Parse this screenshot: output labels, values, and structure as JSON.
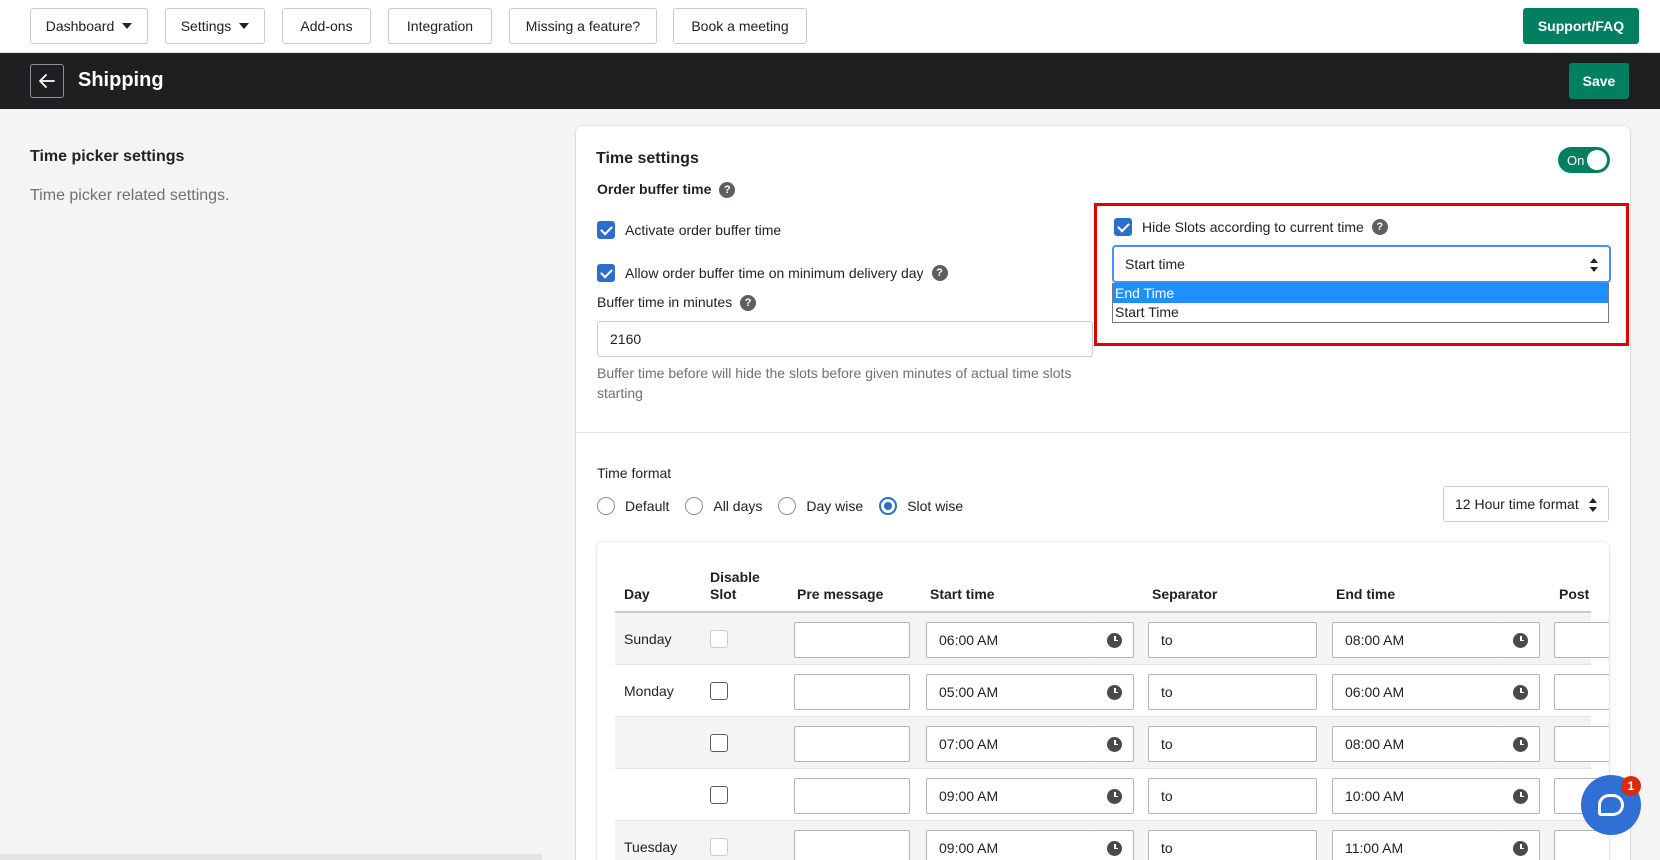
{
  "nav": {
    "dashboard": "Dashboard",
    "settings": "Settings",
    "addons": "Add-ons",
    "integration": "Integration",
    "missing_feature": "Missing a feature?",
    "book_meeting": "Book a meeting",
    "support": "Support/FAQ"
  },
  "header": {
    "title": "Shipping",
    "save": "Save",
    "back_icon": "arrow-left-icon"
  },
  "section": {
    "title": "Time picker settings",
    "description": "Time picker related settings."
  },
  "time_settings": {
    "title": "Time settings",
    "toggle_label": "On",
    "toggle_on": true,
    "order_buffer_label": "Order buffer time",
    "activate_buffer": "Activate order buffer time",
    "activate_buffer_checked": true,
    "allow_buffer_min_day": "Allow order buffer time on minimum delivery day",
    "allow_buffer_min_day_checked": true,
    "buffer_minutes_label": "Buffer time in minutes",
    "buffer_minutes_value": "2160",
    "buffer_help_line1": "Buffer time before will hide the slots before given minutes of actual time slots",
    "buffer_help_line2": "starting",
    "hide_slots_label": "Hide Slots according to current time",
    "hide_slots_checked": true,
    "hide_slots_select_value": "Start time",
    "hide_slots_options": [
      "End Time",
      "Start Time"
    ],
    "hide_slots_highlighted_option": "End Time"
  },
  "time_format": {
    "label": "Time format",
    "options": [
      "Default",
      "All days",
      "Day wise",
      "Slot wise"
    ],
    "selected": "Slot wise",
    "hour_format": "12 Hour time format"
  },
  "table": {
    "headers": {
      "day": "Day",
      "disable_slot_1": "Disable",
      "disable_slot_2": "Slot",
      "pre_message": "Pre message",
      "start_time": "Start time",
      "separator": "Separator",
      "end_time": "End time",
      "post": "Post"
    },
    "rows": [
      {
        "day": "Sunday",
        "disabled_box": true,
        "start": "06:00 AM",
        "sep": "to",
        "end": "08:00 AM"
      },
      {
        "day": "Monday",
        "disabled_box": false,
        "start": "05:00 AM",
        "sep": "to",
        "end": "06:00 AM"
      },
      {
        "day": "",
        "disabled_box": false,
        "start": "07:00 AM",
        "sep": "to",
        "end": "08:00 AM"
      },
      {
        "day": "",
        "disabled_box": false,
        "start": "09:00 AM",
        "sep": "to",
        "end": "10:00 AM"
      },
      {
        "day": "Tuesday",
        "disabled_box": true,
        "start": "09:00 AM",
        "sep": "to",
        "end": "11:00 AM"
      }
    ]
  },
  "chat": {
    "badge": "1"
  },
  "colors": {
    "primary": "#008060",
    "accent": "#2c6ecb",
    "highlight_box": "#e00000",
    "titlebar": "#1e1f21"
  }
}
